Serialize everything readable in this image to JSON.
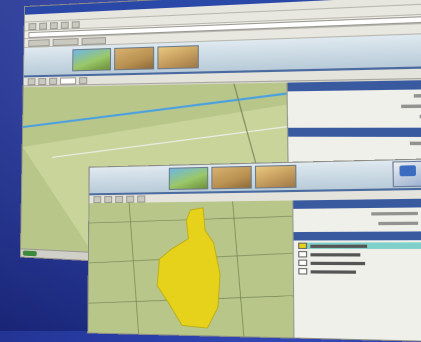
{
  "back_window": {
    "menu": [
      "",
      "",
      "",
      "",
      "",
      ""
    ],
    "panel_rows": 5
  },
  "front_window": {
    "panel_rows": 6
  },
  "colors": {
    "background": "#2a3ea8",
    "map_green": "#b8c68a",
    "parcel_yellow": "#e6d21a",
    "header_blue": "#3a5aa0"
  },
  "icons": [
    "back-icon",
    "forward-icon",
    "refresh-icon",
    "zoom-in-icon",
    "zoom-out-icon",
    "pan-icon",
    "identify-icon"
  ]
}
